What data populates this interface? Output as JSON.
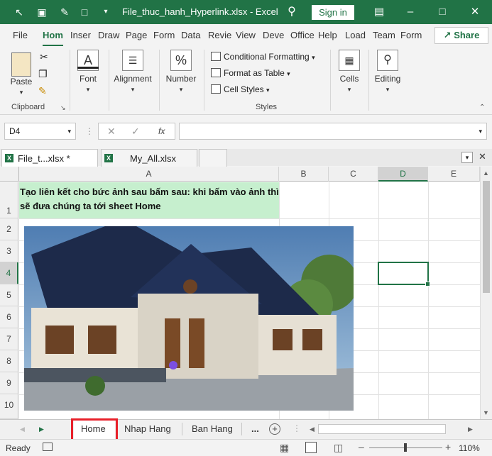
{
  "window": {
    "file_name": "File_thuc_hanh_Hyperlink.xlsx",
    "separator": "-",
    "app_name": "Excel",
    "sign_in": "Sign in"
  },
  "menu_tabs": [
    "File",
    "Hom",
    "Inser",
    "Draw",
    "Page",
    "Form",
    "Data",
    "Revie",
    "View",
    "Deve",
    "Office",
    "Help",
    "Load",
    "Team",
    "Form"
  ],
  "share_label": "Share",
  "ribbon": {
    "paste": "Paste",
    "clipboard": "Clipboard",
    "font": "Font",
    "alignment": "Alignment",
    "number": "Number",
    "conditional_formatting": "Conditional Formatting",
    "format_as_table": "Format as Table",
    "cell_styles": "Cell Styles",
    "styles": "Styles",
    "cells": "Cells",
    "editing": "Editing"
  },
  "formula_bar": {
    "name_box": "D4",
    "fx": "fx",
    "formula": ""
  },
  "workbook_tabs": [
    {
      "label": "File_t...xlsx *"
    },
    {
      "label": "My_All.xlsx"
    }
  ],
  "columns": [
    "A",
    "B",
    "C",
    "D",
    "E"
  ],
  "rows": [
    "1",
    "2",
    "3",
    "4",
    "5",
    "6",
    "7",
    "8",
    "9",
    "10"
  ],
  "cell_a1": "Tạo liên kết cho bức ảnh sau bấm sau: khi bấm vào ảnh thì sẽ đưa chúng ta tới sheet Home",
  "sheets": [
    "Home",
    "Nhap Hang",
    "Ban Hang"
  ],
  "sheet_more": "...",
  "status": {
    "ready": "Ready",
    "zoom": "110%"
  },
  "colors": {
    "brand": "#217346",
    "highlight_cell": "#c6efce",
    "annotation_box": "#e8202a"
  }
}
